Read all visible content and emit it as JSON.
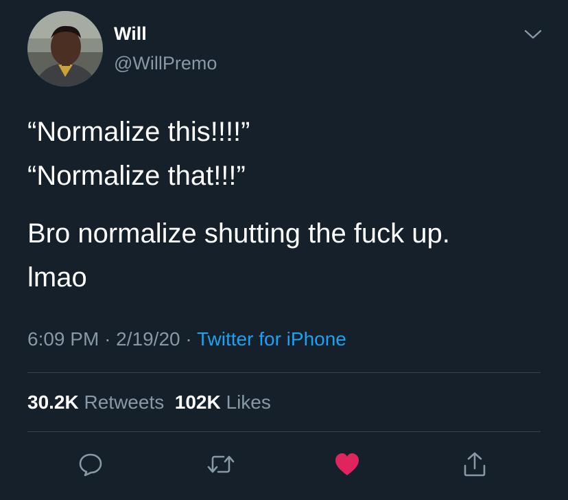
{
  "user": {
    "display_name": "Will",
    "handle": "@WillPremo",
    "avatar_icon": "profile-photo"
  },
  "tweet": {
    "lines": [
      "“Normalize this!!!!”",
      "“Normalize that!!!”",
      "Bro normalize shutting the fuck up.",
      "lmao"
    ]
  },
  "meta": {
    "time": "6:09 PM",
    "date": "2/19/20",
    "separator": "·",
    "source": "Twitter for iPhone"
  },
  "stats": {
    "retweets_count": "30.2K",
    "retweets_label": "Retweets",
    "likes_count": "102K",
    "likes_label": "Likes"
  },
  "actions": [
    {
      "name": "reply",
      "icon": "speech-bubble-icon"
    },
    {
      "name": "retweet",
      "icon": "retweet-icon"
    },
    {
      "name": "like",
      "icon": "heart-icon",
      "active": true
    },
    {
      "name": "share",
      "icon": "share-icon"
    }
  ],
  "colors": {
    "background": "#15202b",
    "primary_text": "#ffffff",
    "secondary_text": "#8899a6",
    "link": "#1da1f2",
    "like_active": "#e0245e",
    "divider": "#38444d"
  }
}
